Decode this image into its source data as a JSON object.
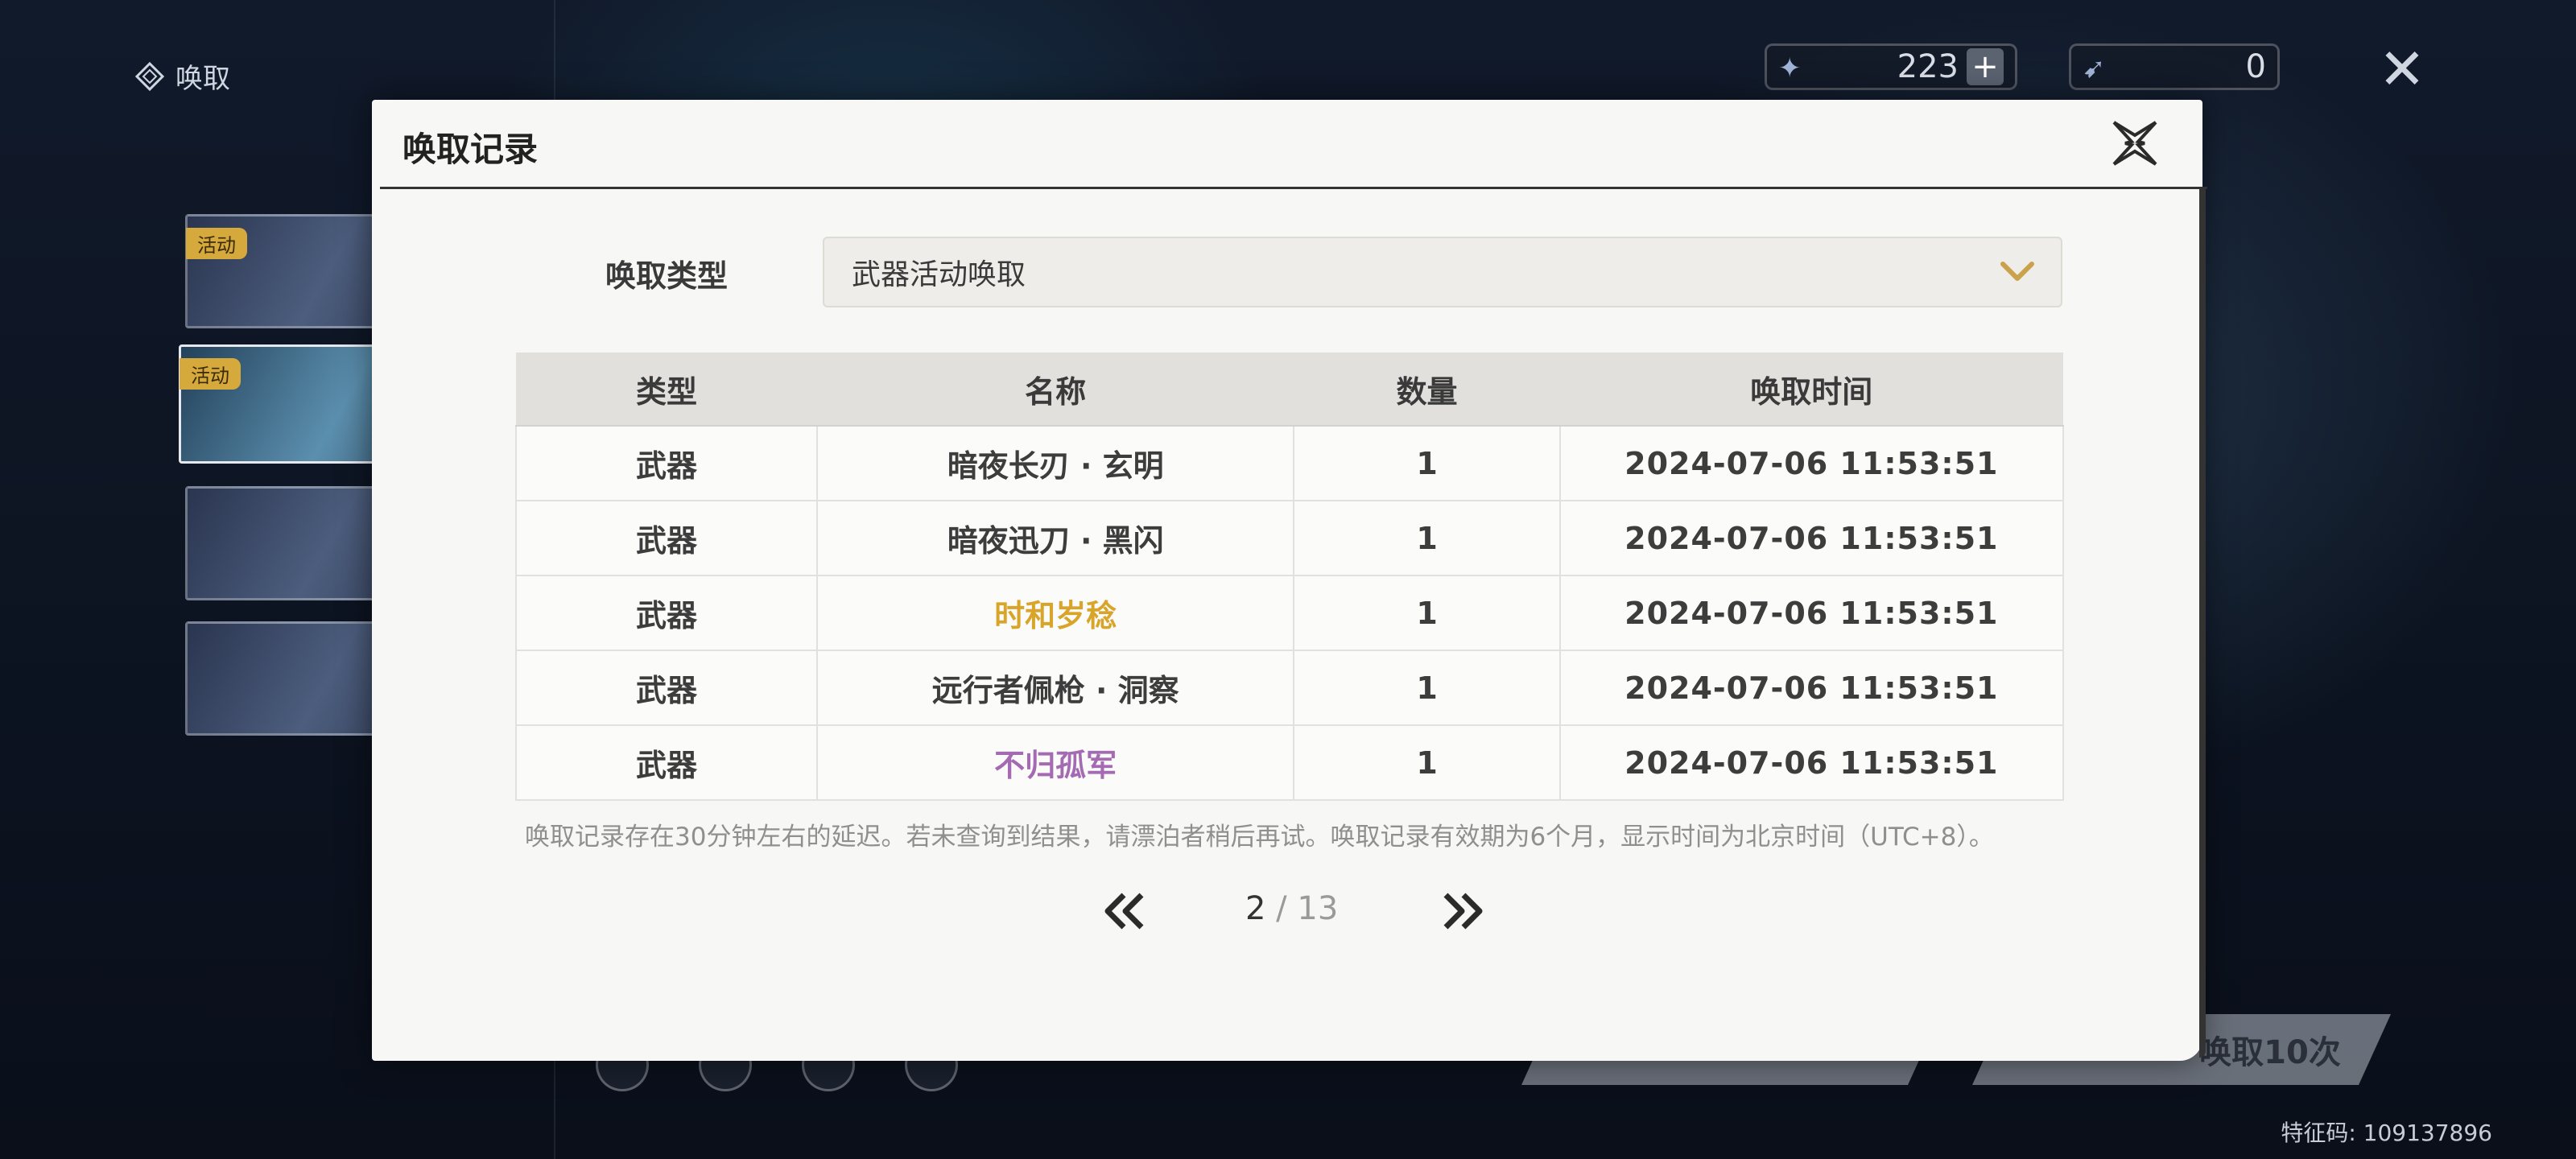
{
  "background": {
    "section_title": "唤取",
    "banner_tag": "活动",
    "currencies": [
      {
        "value": "223",
        "icon": "star-crystal-icon"
      },
      {
        "value": "0",
        "icon": "feather-tide-icon"
      }
    ],
    "pull_button_label": "唤取10次",
    "feature_code": "特征码: 109137896"
  },
  "modal": {
    "title": "唤取记录",
    "type_label": "唤取类型",
    "type_selected": "武器活动唤取",
    "columns": [
      "类型",
      "名称",
      "数量",
      "唤取时间"
    ],
    "rows": [
      {
        "type": "武器",
        "name": "暗夜长刃 · 玄明",
        "qty": "1",
        "time": "2024-07-06 11:53:51",
        "rarity_color": ""
      },
      {
        "type": "武器",
        "name": "暗夜迅刀 · 黑闪",
        "qty": "1",
        "time": "2024-07-06 11:53:51",
        "rarity_color": ""
      },
      {
        "type": "武器",
        "name": "时和岁稔",
        "qty": "1",
        "time": "2024-07-06 11:53:51",
        "rarity_color": "#d8a52a"
      },
      {
        "type": "武器",
        "name": "远行者佩枪 · 洞察",
        "qty": "1",
        "time": "2024-07-06 11:53:51",
        "rarity_color": ""
      },
      {
        "type": "武器",
        "name": "不归孤军",
        "qty": "1",
        "time": "2024-07-06 11:53:51",
        "rarity_color": "#a46bb3"
      }
    ],
    "notice": "唤取记录存在30分钟左右的延迟。若未查询到结果，请漂泊者稍后再试。唤取记录有效期为6个月，显示时间为北京时间（UTC+8）。",
    "pager": {
      "current": "2",
      "total": "/ 13"
    }
  }
}
